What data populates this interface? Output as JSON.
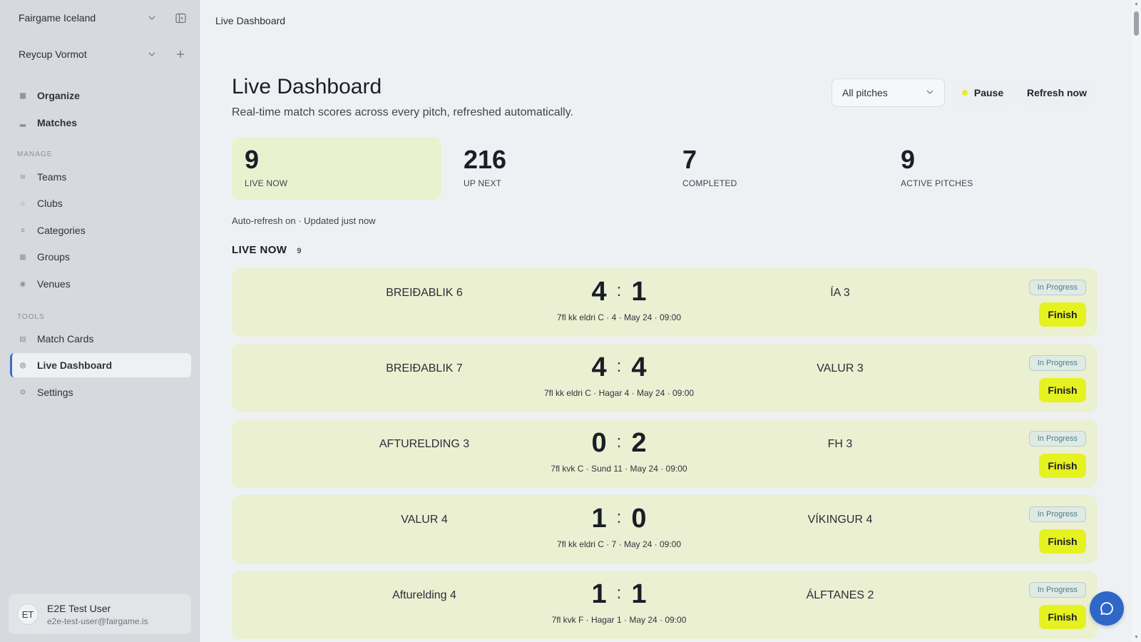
{
  "sidebar": {
    "org_name": "Fairgame Iceland",
    "tournament_name": "Reycup Vormot",
    "primary_items": [
      {
        "label": "Organize",
        "icon": "grid-icon"
      },
      {
        "label": "Matches",
        "icon": "bar-chart-icon"
      }
    ],
    "manage_heading": "MANAGE",
    "manage_items": [
      {
        "label": "Teams",
        "icon": "users-icon"
      },
      {
        "label": "Clubs",
        "icon": "building-icon"
      },
      {
        "label": "Categories",
        "icon": "list-icon"
      },
      {
        "label": "Groups",
        "icon": "grid-icon"
      },
      {
        "label": "Venues",
        "icon": "map-pin-icon"
      }
    ],
    "tools_heading": "TOOLS",
    "tools_items": [
      {
        "label": "Match Cards",
        "icon": "cards-icon"
      },
      {
        "label": "Live Dashboard",
        "icon": "radio-icon",
        "active": true
      },
      {
        "label": "Settings",
        "icon": "gear-icon"
      }
    ],
    "user": {
      "initials": "ET",
      "name": "E2E Test User",
      "email": "e2e-test-user@fairgame.is"
    }
  },
  "breadcrumb": "Live Dashboard",
  "page": {
    "title": "Live Dashboard",
    "subtitle": "Real-time match scores across every pitch, refreshed automatically.",
    "pitch_filter": "All pitches",
    "pause_label": "Pause",
    "refresh_label": "Refresh now",
    "accent_color": "#e6f21f"
  },
  "stats": [
    {
      "value": "9",
      "label": "LIVE NOW"
    },
    {
      "value": "216",
      "label": "UP NEXT"
    },
    {
      "value": "7",
      "label": "COMPLETED"
    },
    {
      "value": "9",
      "label": "ACTIVE PITCHES"
    }
  ],
  "auto_refresh_text": "Auto-refresh on · Updated just now",
  "live_section": {
    "heading": "LIVE NOW",
    "count": "9"
  },
  "matches": [
    {
      "home": "BREIÐABLIK 6",
      "home_score": "4",
      "away_score": "1",
      "away": "ÍA 3",
      "meta": "7fl kk eldri C · 4 · May 24 · 09:00",
      "status": "In Progress",
      "action": "Finish"
    },
    {
      "home": "BREIÐABLIK 7",
      "home_score": "4",
      "away_score": "4",
      "away": "VALUR 3",
      "meta": "7fl kk eldri C · Hagar 4 · May 24 · 09:00",
      "status": "In Progress",
      "action": "Finish"
    },
    {
      "home": "AFTURELDING 3",
      "home_score": "0",
      "away_score": "2",
      "away": "FH 3",
      "meta": "7fl kvk C · Sund 11 · May 24 · 09:00",
      "status": "In Progress",
      "action": "Finish"
    },
    {
      "home": "VALUR 4",
      "home_score": "1",
      "away_score": "0",
      "away": "VÍKINGUR 4",
      "meta": "7fl kk eldri C · 7 · May 24 · 09:00",
      "status": "In Progress",
      "action": "Finish"
    },
    {
      "home": "Afturelding 4",
      "home_score": "1",
      "away_score": "1",
      "away": "ÁLFTANES 2",
      "meta": "7fl kvk F · Hagar 1 · May 24 · 09:00",
      "status": "In Progress",
      "action": "Finish"
    }
  ]
}
